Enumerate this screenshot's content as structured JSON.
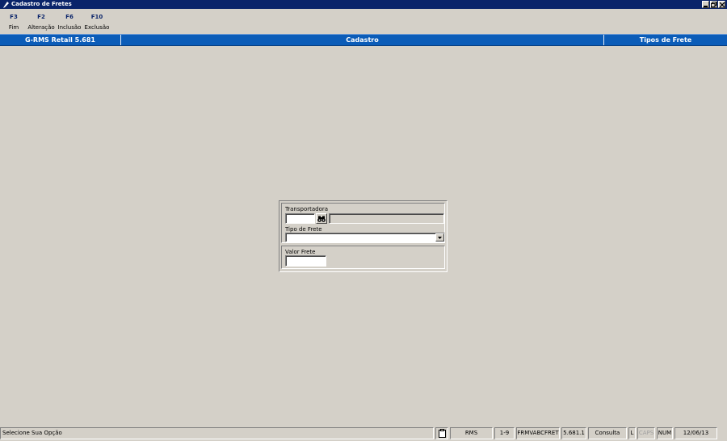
{
  "window": {
    "title": "Cadastro de Fretes"
  },
  "toolbar": {
    "items": [
      {
        "key": "F3",
        "label": "Fim"
      },
      {
        "key": "F2",
        "label": "Alteração"
      },
      {
        "key": "F6",
        "label": "Inclusão"
      },
      {
        "key": "F10",
        "label": "Exclusão"
      }
    ]
  },
  "header": {
    "product": "G-RMS Retail 5.681",
    "section": "Cadastro",
    "context": "Tipos de Frete"
  },
  "form": {
    "transportadora": {
      "label": "Transportadora",
      "code_value": "",
      "name_value": ""
    },
    "tipo_frete": {
      "label": "Tipo de Frete",
      "value": ""
    },
    "valor_frete": {
      "label": "Valor Frete",
      "value": ""
    }
  },
  "status": {
    "message": "Selecione Sua Opção",
    "system": "RMS",
    "record": "1-9",
    "form_id": "FRMVABCFRET",
    "version": "5.681.1",
    "mode": "Consulta",
    "flag_l": "L",
    "caps": "CAPS",
    "num": "NUM",
    "date": "12/06/13"
  },
  "colors": {
    "titlebar": "#0a246a",
    "band": "#0b5cb8",
    "background": "#d4d0c8",
    "key_text": "#0a246a"
  },
  "icons": {
    "app": "pen-icon",
    "search": "binoculars-icon",
    "dropdown": "chevron-down-icon",
    "clipboard": "clipboard-icon"
  }
}
